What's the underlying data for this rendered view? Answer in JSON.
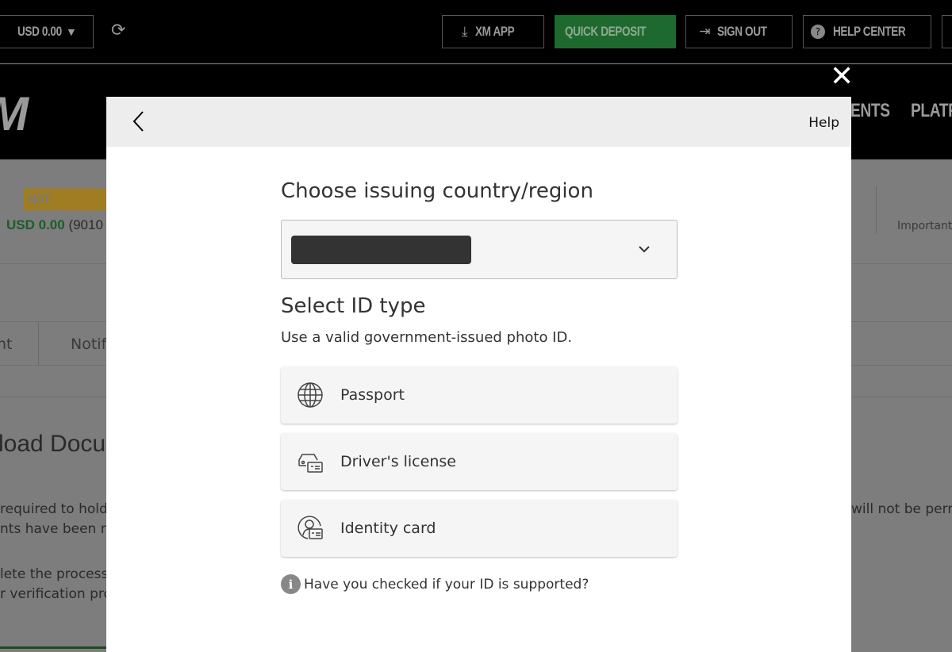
{
  "topbar": {
    "balance": "USD 0.00",
    "xm_app": "XM APP",
    "quick_deposit": "QUICK DEPOSIT",
    "sign_out": "SIGN OUT",
    "help_center": "HELP CENTER"
  },
  "nav": {
    "logo": "XM",
    "items": [
      "ENTS",
      "PLATF"
    ]
  },
  "background": {
    "status_badge": "NOT VERIFIE",
    "balance_label": "USD 0.00",
    "account": "(9010",
    "important": "Important",
    "tabs": [
      "nt",
      "Notif"
    ],
    "heading": "load Docu",
    "para1": [
      "required to hold",
      "nts have been re"
    ],
    "para2": [
      "lete the process",
      "r verification pro"
    ],
    "right_text": "will not be perm"
  },
  "modal": {
    "help": "Help",
    "country_title": "Choose issuing country/region",
    "id_title": "Select ID type",
    "id_subtitle": "Use a valid government-issued photo ID.",
    "options": [
      {
        "label": "Passport",
        "icon": "globe-icon"
      },
      {
        "label": "Driver's license",
        "icon": "car-card-icon"
      },
      {
        "label": "Identity card",
        "icon": "person-card-icon"
      }
    ],
    "info_text": "Have you checked if your ID is supported?"
  },
  "colors": {
    "accent": "#1e7b34",
    "badge": "#b08a2a"
  }
}
